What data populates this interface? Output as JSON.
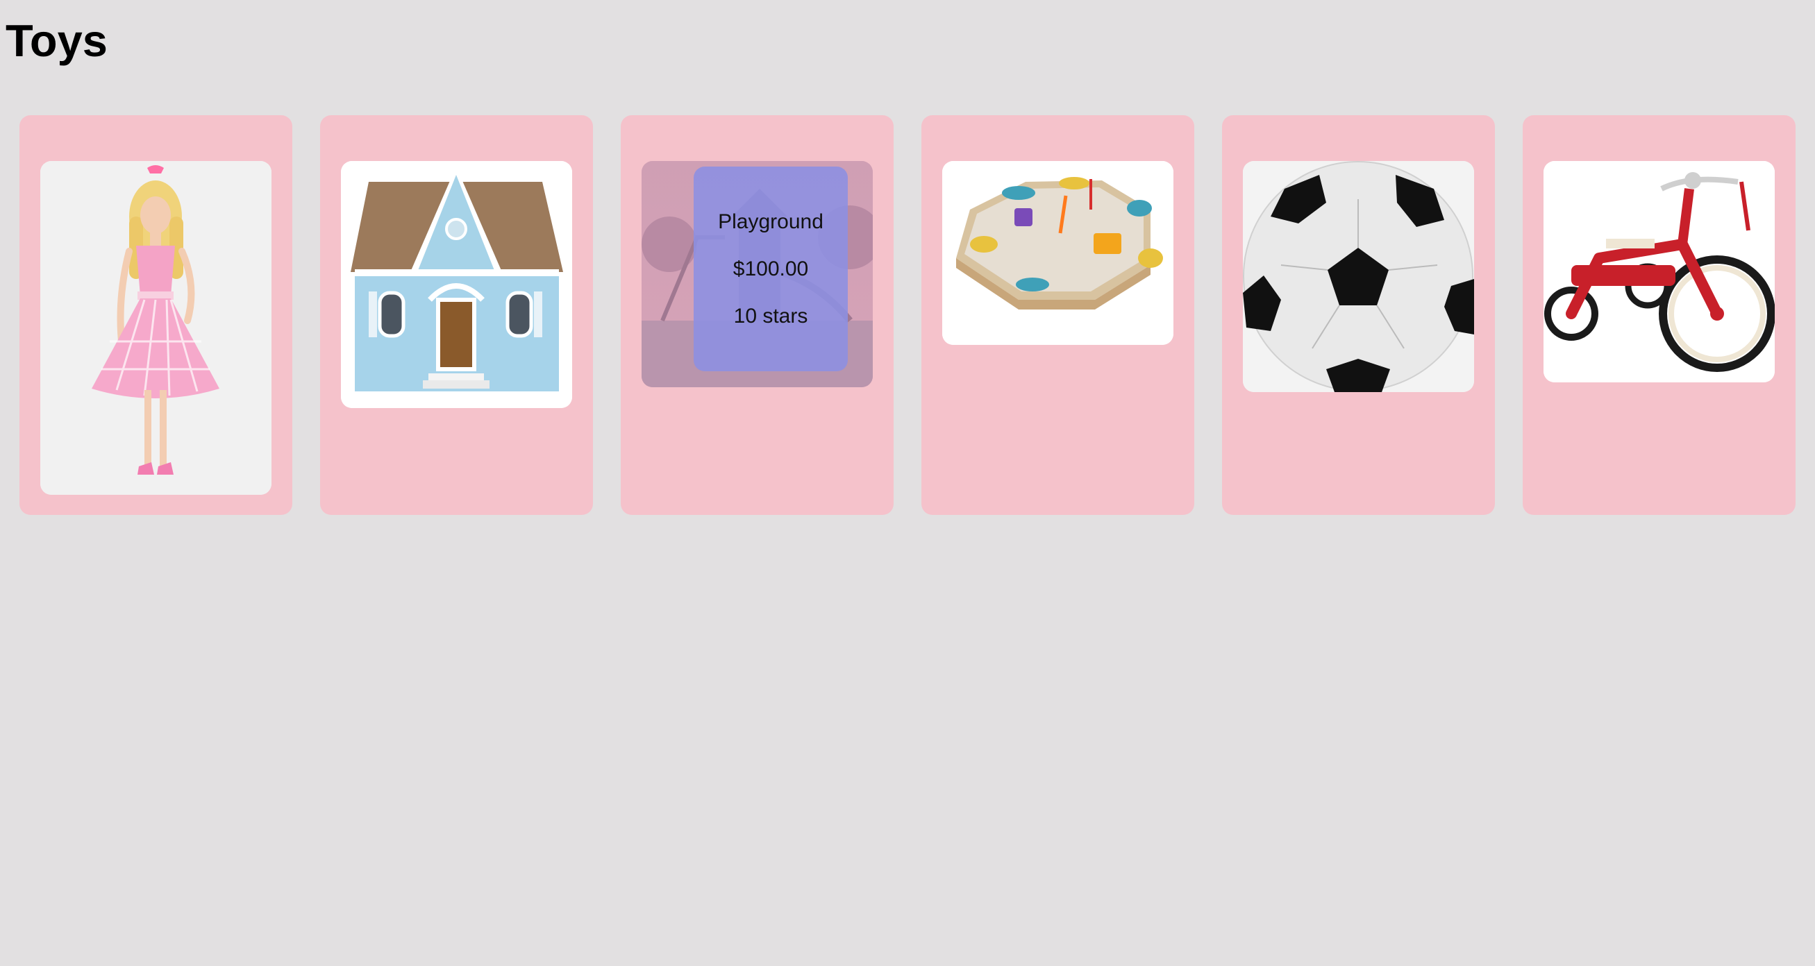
{
  "page": {
    "title": "Toys"
  },
  "products": [
    {
      "image_alt": "Barbie doll in pink gingham dress"
    },
    {
      "image_alt": "Blue dollhouse"
    },
    {
      "name": "Playground",
      "price": "$100.00",
      "rating": "10 stars",
      "image_alt": "Playground"
    },
    {
      "image_alt": "Sandbox with toys"
    },
    {
      "image_alt": "Soccer ball"
    },
    {
      "image_alt": "Red tricycle"
    }
  ],
  "colors": {
    "background": "#e2e0e1",
    "card": "#f5c2cb",
    "hover_overlay": "#8c90e2"
  }
}
